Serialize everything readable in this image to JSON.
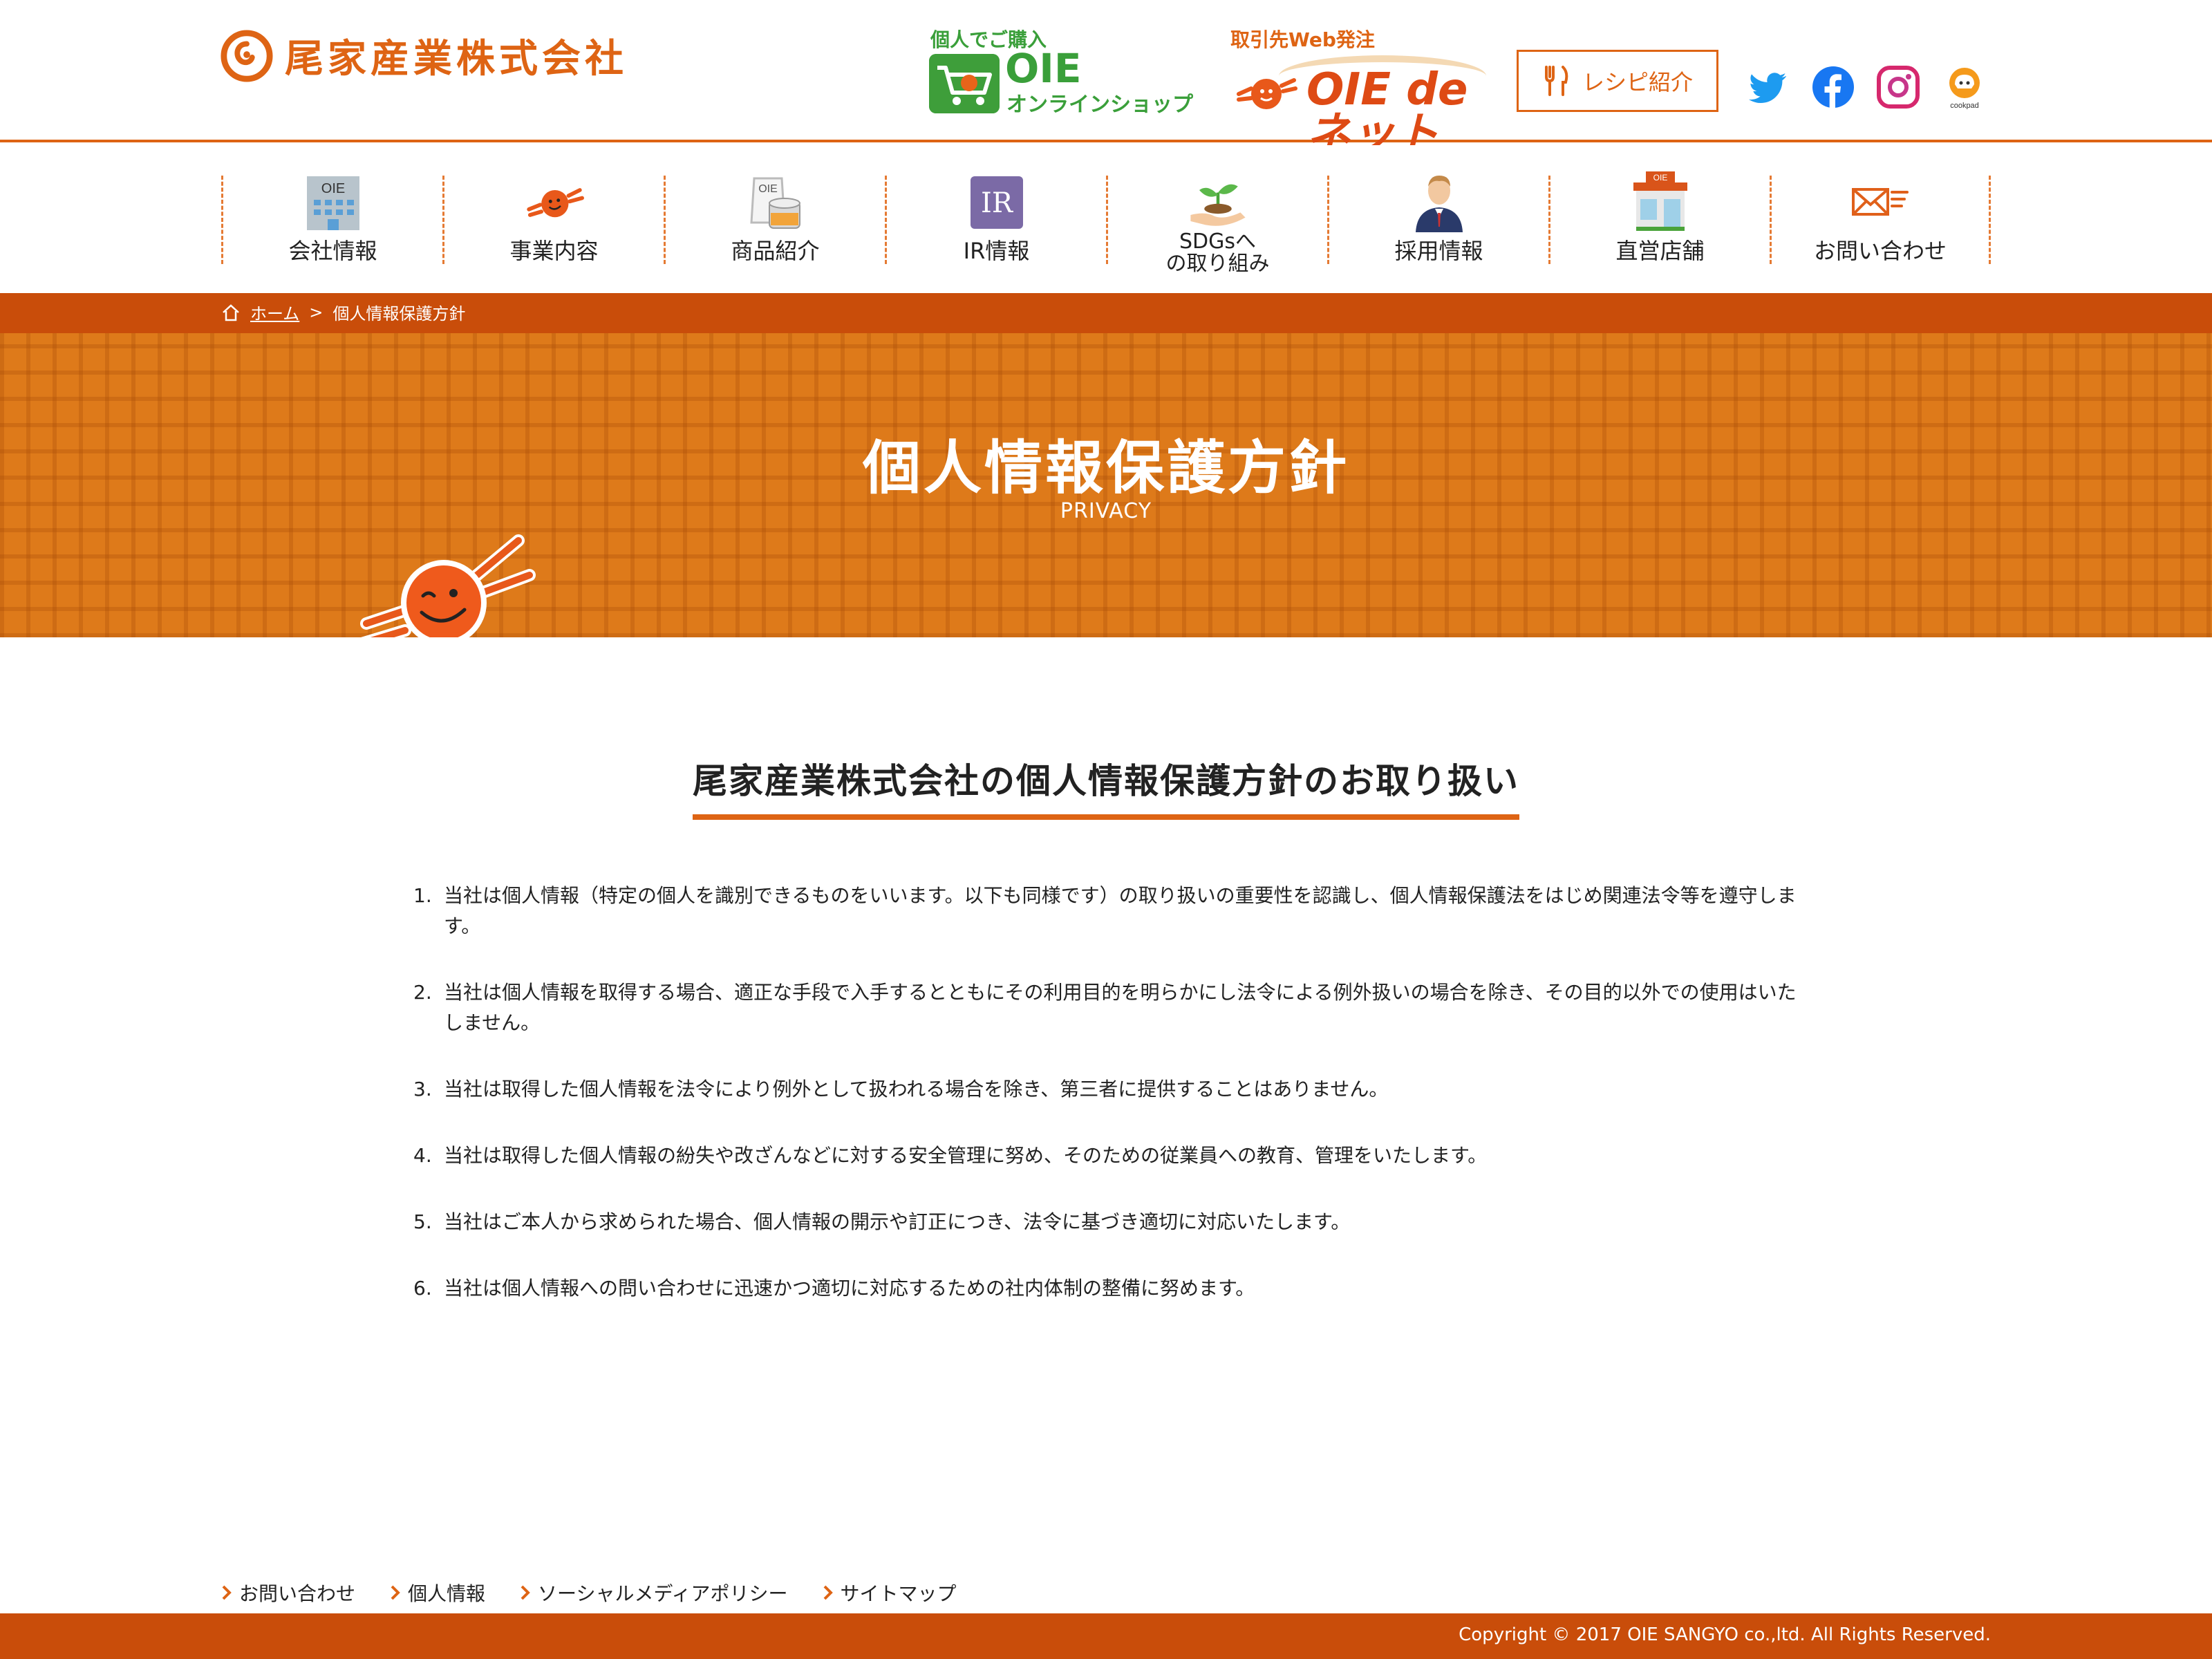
{
  "header": {
    "company_name": "尾家産業株式会社",
    "shop": {
      "caption": "個人でご購入",
      "name": "OIE",
      "sub": "オンラインショップ"
    },
    "web_order": {
      "caption": "取引先Web発注",
      "name": "OIE de ネット"
    },
    "recipe_label": "レシピ紹介",
    "sns": [
      "twitter-icon",
      "facebook-icon",
      "instagram-icon",
      "cookpad-icon"
    ],
    "cookpad_label": "cookpad"
  },
  "nav": {
    "items": [
      {
        "label": "会社情報",
        "icon": "building-icon"
      },
      {
        "label": "事業内容",
        "icon": "mascot-icon"
      },
      {
        "label": "商品紹介",
        "icon": "products-icon"
      },
      {
        "label": "IR情報",
        "icon": "ir-icon"
      },
      {
        "label": "SDGsへ\nの取り組み",
        "icon": "sprout-icon"
      },
      {
        "label": "採用情報",
        "icon": "person-icon"
      },
      {
        "label": "直営店舗",
        "icon": "store-icon"
      },
      {
        "label": "お問い合わせ",
        "icon": "mail-icon"
      }
    ],
    "store_sign": "OIE",
    "building_sign": "OIE",
    "products_label": "OIE",
    "ir_label": "IR"
  },
  "breadcrumb": {
    "home": "ホーム",
    "separator": ">",
    "current": "個人情報保護方針"
  },
  "hero": {
    "title": "個人情報保護方針",
    "subtitle": "PRIVACY"
  },
  "content": {
    "title": "尾家産業株式会社の個人情報保護方針のお取り扱い",
    "items": [
      {
        "num": "1.",
        "text": "当社は個人情報（特定の個人を識別できるものをいいます。以下も同様です）の取り扱いの重要性を認識し、個人情報保護法をはじめ関連法令等を遵守します。"
      },
      {
        "num": "2.",
        "text": "当社は個人情報を取得する場合、適正な手段で入手するとともにその利用目的を明らかにし法令による例外扱いの場合を除き、その目的以外での使用はいたしません。"
      },
      {
        "num": "3.",
        "text": "当社は取得した個人情報を法令により例外として扱われる場合を除き、第三者に提供することはありません。"
      },
      {
        "num": "4.",
        "text": "当社は取得した個人情報の紛失や改ざんなどに対する安全管理に努め、そのための従業員への教育、管理をいたします。"
      },
      {
        "num": "5.",
        "text": "当社はご本人から求められた場合、個人情報の開示や訂正につき、法令に基づき適切に対応いたします。"
      },
      {
        "num": "6.",
        "text": "当社は個人情報への問い合わせに迅速かつ適切に対応するための社内体制の整備に努めます。"
      }
    ]
  },
  "footer": {
    "links": [
      "お問い合わせ",
      "個人情報",
      "ソーシャルメディアポリシー",
      "サイトマップ"
    ],
    "copyright": "Copyright © 2017 OIE SANGYO co.,ltd. All Rights Reserved."
  },
  "colors": {
    "brand": "#de6414",
    "brand_dark": "#c94d0a",
    "shop_green": "#3a9f3a",
    "ir_purple": "#7b6aa6"
  }
}
